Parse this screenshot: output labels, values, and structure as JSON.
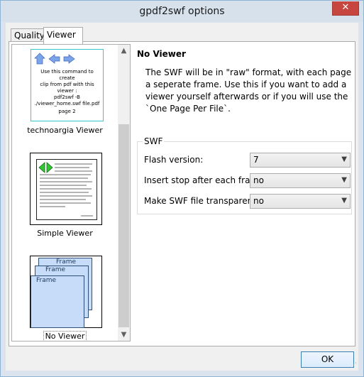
{
  "window": {
    "title": "gpdf2swf options",
    "close_symbol": "✕"
  },
  "tabs": [
    {
      "label": "Quality"
    },
    {
      "label": "Viewer"
    }
  ],
  "viewer_list": {
    "items": [
      {
        "label": "technoargia Viewer",
        "thumb_lines": [
          "Use this command to create",
          "clip from pdf with this",
          "viewer :",
          "pdf2swf -B",
          "./viewer_home.swf file.pdf"
        ],
        "thumb_page": "page 2"
      },
      {
        "label": "Simple Viewer"
      },
      {
        "label": "No Viewer",
        "frames": [
          "Frame",
          "Frame",
          "Frame"
        ]
      }
    ],
    "selected_index": 2
  },
  "details": {
    "heading": "No Viewer",
    "description": "The SWF will be in \"raw\" format, with each page a seperate frame. Use this if you want to add a viewer yourself afterwards or if you will use the `One Page Per File`."
  },
  "swf_group": {
    "title": "SWF",
    "rows": [
      {
        "label": "Flash version:",
        "value": "7"
      },
      {
        "label": "Insert stop after each frame:",
        "value": "no"
      },
      {
        "label": "Make SWF file transparent:",
        "value": "no"
      }
    ]
  },
  "buttons": {
    "ok": "OK"
  }
}
